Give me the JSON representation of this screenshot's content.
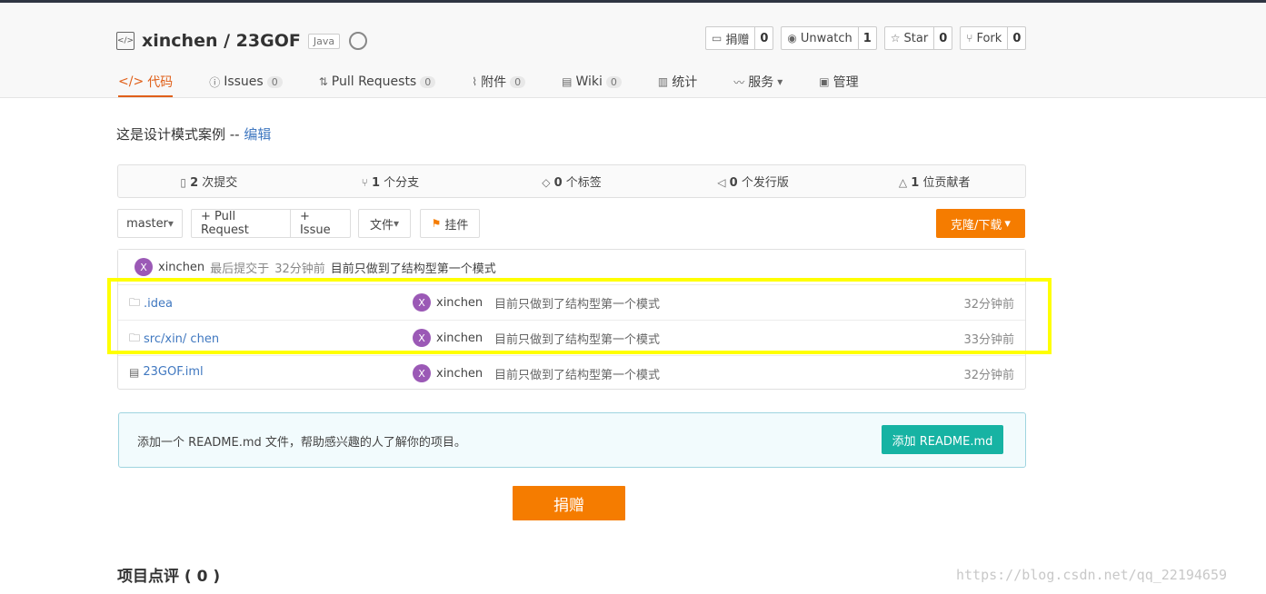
{
  "header": {
    "repo_owner_name": "xinchen / 23GOF",
    "language": "Java",
    "actions": [
      {
        "label": "捐赠",
        "count": "0",
        "icon": "donate-icon"
      },
      {
        "label": "Unwatch",
        "count": "1",
        "icon": "eye-icon"
      },
      {
        "label": "Star",
        "count": "0",
        "icon": "star-icon"
      },
      {
        "label": "Fork",
        "count": "0",
        "icon": "fork-icon"
      }
    ],
    "tabs": [
      {
        "label": "代码",
        "count": null,
        "icon": "code-icon"
      },
      {
        "label": "Issues",
        "count": "0",
        "icon": "issue-icon"
      },
      {
        "label": "Pull Requests",
        "count": "0",
        "icon": "pull-request-icon"
      },
      {
        "label": "附件",
        "count": "0",
        "icon": "attachment-icon"
      },
      {
        "label": "Wiki",
        "count": "0",
        "icon": "wiki-icon"
      },
      {
        "label": "统计",
        "count": null,
        "icon": "stats-icon"
      },
      {
        "label": "服务",
        "count": null,
        "icon": "service-icon"
      },
      {
        "label": "管理",
        "count": null,
        "icon": "manage-icon"
      }
    ]
  },
  "description": {
    "text": "这是设计模式案例 -- ",
    "edit_link": "编辑"
  },
  "stats": [
    {
      "num": "2",
      "label": "次提交"
    },
    {
      "num": "1",
      "label": "个分支"
    },
    {
      "num": "0",
      "label": "个标签"
    },
    {
      "num": "0",
      "label": "个发行版"
    },
    {
      "num": "1",
      "label": "位贡献者"
    }
  ],
  "toolbar": {
    "branch": "master",
    "pull_request": "+ Pull Request",
    "issue": "+ Issue",
    "file": "文件",
    "pin": "挂件",
    "clone": "克隆/下载"
  },
  "last_commit": {
    "avatar": "X",
    "author": "xinchen",
    "prefix": "最后提交于",
    "time": "32分钟前",
    "message": "目前只做到了结构型第一个模式"
  },
  "files": [
    {
      "name": ".idea",
      "type": "folder",
      "avatar": "X",
      "author": "xinchen",
      "message": "目前只做到了结构型第一个模式",
      "time": "32分钟前"
    },
    {
      "name": "src/xin/ chen",
      "type": "folder",
      "avatar": "X",
      "author": "xinchen",
      "message": "目前只做到了结构型第一个模式",
      "time": "33分钟前"
    },
    {
      "name": "23GOF.iml",
      "type": "file",
      "avatar": "X",
      "author": "xinchen",
      "message": "目前只做到了结构型第一个模式",
      "time": "32分钟前"
    }
  ],
  "readme": {
    "text": "添加一个 README.md 文件，帮助感兴趣的人了解你的项目。",
    "button": "添加 README.md"
  },
  "donate_button": "捐赠",
  "review_title": "项目点评 ( 0 )",
  "watermark": "https://blog.csdn.net/qq_22194659"
}
